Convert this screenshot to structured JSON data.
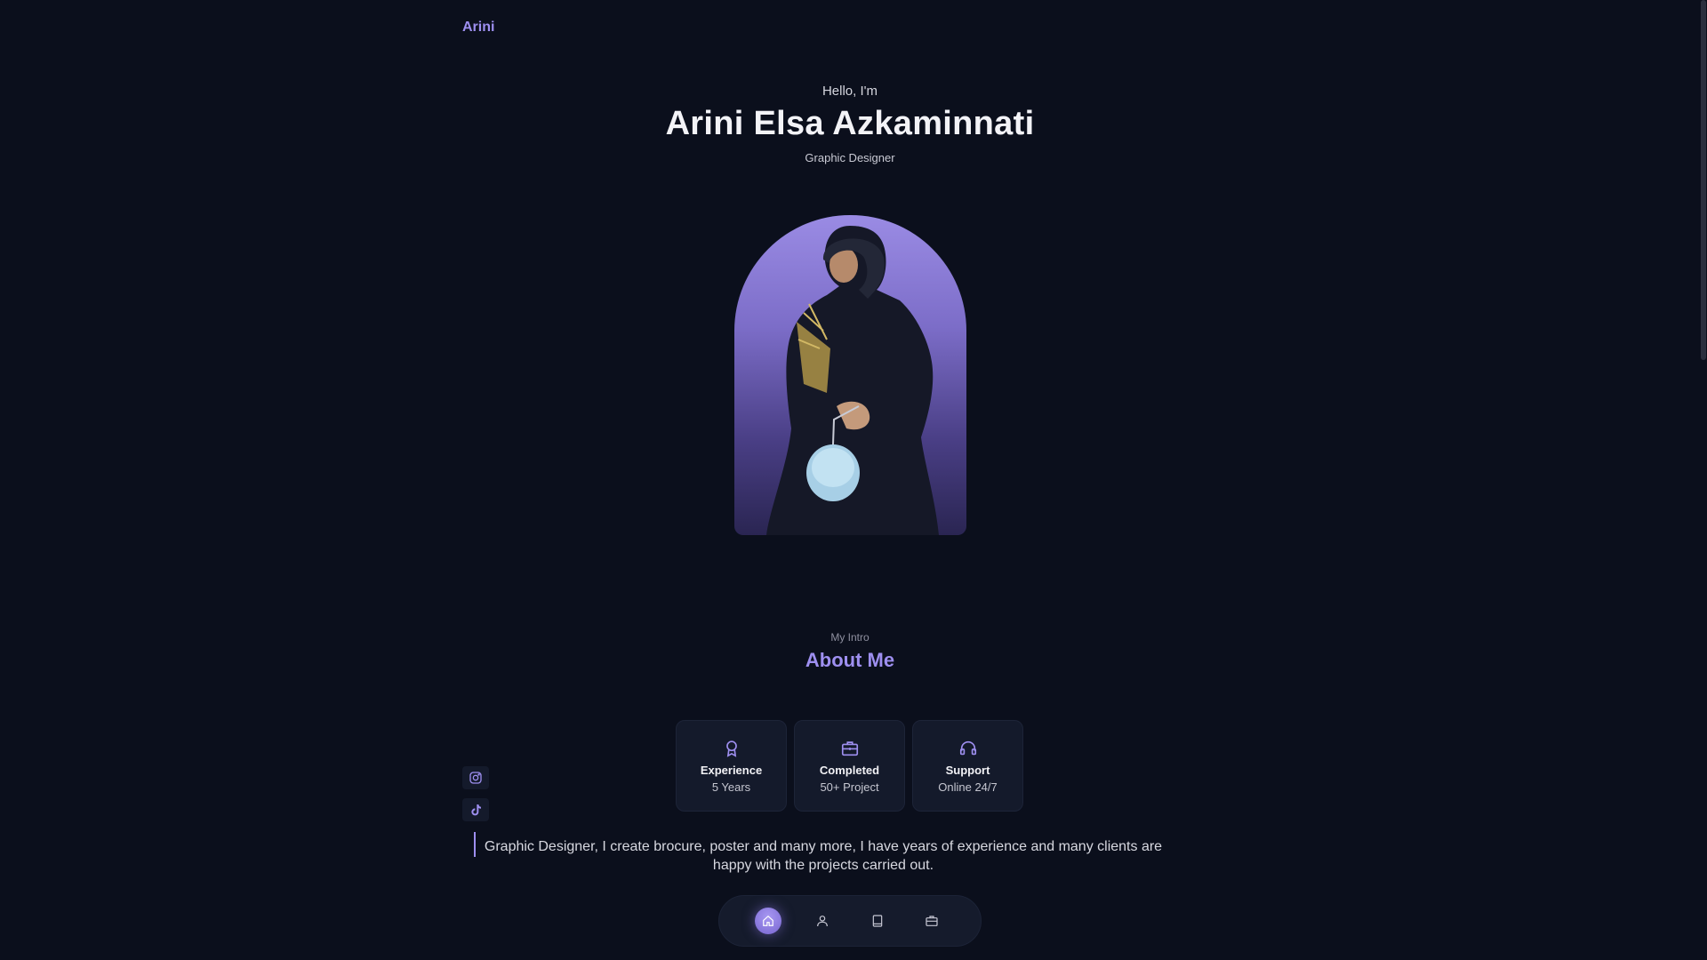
{
  "header": {
    "logo": "Arini"
  },
  "hero": {
    "greeting": "Hello, I'm",
    "name": "Arini Elsa Azkaminnati",
    "role": "Graphic Designer"
  },
  "about": {
    "subtitle": "My Intro",
    "title": "About Me",
    "cards": [
      {
        "icon": "award-icon",
        "title": "Experience",
        "value": "5 Years"
      },
      {
        "icon": "briefcase-icon",
        "title": "Completed",
        "value": "50+ Project"
      },
      {
        "icon": "headset-icon",
        "title": "Support",
        "value": "Online 24/7"
      }
    ],
    "description": "Graphic Designer, I create brocure, poster and many more, I have years of experience and many clients are happy with the projects carried out."
  },
  "social": [
    {
      "icon": "instagram-icon"
    },
    {
      "icon": "tiktok-icon"
    }
  ],
  "nav": {
    "items": [
      {
        "icon": "home-icon",
        "active": true
      },
      {
        "icon": "user-icon",
        "active": false
      },
      {
        "icon": "book-icon",
        "active": false
      },
      {
        "icon": "briefcase-icon",
        "active": false
      }
    ]
  },
  "colors": {
    "background": "#0b0f1c",
    "accent": "#9e8ff0",
    "card": "#141a2b"
  }
}
